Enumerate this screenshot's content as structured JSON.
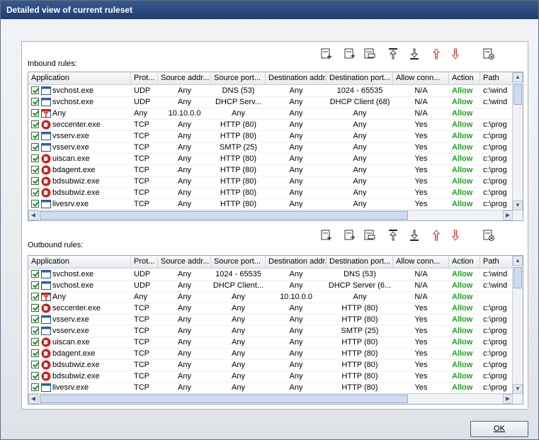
{
  "window": {
    "title": "Detailed view of current ruleset"
  },
  "inbound": {
    "label": "Inbound rules:",
    "columns": [
      "Application",
      "Prot...",
      "Source addr...",
      "Source port...",
      "Destination addr...",
      "Destination port...",
      "Allow conn...",
      "Action",
      "Path"
    ],
    "rows": [
      {
        "app": "svchost.exe",
        "icon": "window-icon",
        "prot": "UDP",
        "src": "Any",
        "sport": "DNS (53)",
        "dst": "Any",
        "dport": "1024 - 65535",
        "conn": "N/A",
        "action": "Allow",
        "path": "c:\\wind"
      },
      {
        "app": "svchost.exe",
        "icon": "window-icon",
        "prot": "UDP",
        "src": "Any",
        "sport": "DHCP Serv...",
        "dst": "Any",
        "dport": "DHCP Client (68)",
        "conn": "N/A",
        "action": "Allow",
        "path": "c:\\wind"
      },
      {
        "app": "Any",
        "icon": "any-icon",
        "prot": "Any",
        "src": "10.10.0.0",
        "sport": "Any",
        "dst": "Any",
        "dport": "Any",
        "conn": "N/A",
        "action": "Allow",
        "path": ""
      },
      {
        "app": "seccenter.exe",
        "icon": "bitdefender-icon",
        "prot": "TCP",
        "src": "Any",
        "sport": "HTTP (80)",
        "dst": "Any",
        "dport": "Any",
        "conn": "Yes",
        "action": "Allow",
        "path": "c:\\prog"
      },
      {
        "app": "vsserv.exe",
        "icon": "window-icon",
        "prot": "TCP",
        "src": "Any",
        "sport": "HTTP (80)",
        "dst": "Any",
        "dport": "Any",
        "conn": "Yes",
        "action": "Allow",
        "path": "c:\\prog"
      },
      {
        "app": "vsserv.exe",
        "icon": "window-icon",
        "prot": "TCP",
        "src": "Any",
        "sport": "SMTP (25)",
        "dst": "Any",
        "dport": "Any",
        "conn": "Yes",
        "action": "Allow",
        "path": "c:\\prog"
      },
      {
        "app": "uiscan.exe",
        "icon": "bitdefender-icon",
        "prot": "TCP",
        "src": "Any",
        "sport": "HTTP (80)",
        "dst": "Any",
        "dport": "Any",
        "conn": "Yes",
        "action": "Allow",
        "path": "c:\\prog"
      },
      {
        "app": "bdagent.exe",
        "icon": "bitdefender-icon",
        "prot": "TCP",
        "src": "Any",
        "sport": "HTTP (80)",
        "dst": "Any",
        "dport": "Any",
        "conn": "Yes",
        "action": "Allow",
        "path": "c:\\prog"
      },
      {
        "app": "bdsubwiz.exe",
        "icon": "bitdefender-icon",
        "prot": "TCP",
        "src": "Any",
        "sport": "HTTP (80)",
        "dst": "Any",
        "dport": "Any",
        "conn": "Yes",
        "action": "Allow",
        "path": "c:\\prog"
      },
      {
        "app": "bdsubwiz.exe",
        "icon": "bitdefender-icon",
        "prot": "TCP",
        "src": "Any",
        "sport": "HTTP (80)",
        "dst": "Any",
        "dport": "Any",
        "conn": "Yes",
        "action": "Allow",
        "path": "c:\\prog"
      },
      {
        "app": "livesrv.exe",
        "icon": "window-icon",
        "prot": "TCP",
        "src": "Any",
        "sport": "HTTP (80)",
        "dst": "Any",
        "dport": "Any",
        "conn": "Yes",
        "action": "Allow",
        "path": "c:\\prog"
      }
    ]
  },
  "outbound": {
    "label": "Outbound rules:",
    "columns": [
      "Application",
      "Prot...",
      "Source addr...",
      "Source port...",
      "Destination addr...",
      "Destination port...",
      "Allow conn...",
      "Action",
      "Path"
    ],
    "rows": [
      {
        "app": "svchost.exe",
        "icon": "window-icon",
        "prot": "UDP",
        "src": "Any",
        "sport": "1024 - 65535",
        "dst": "Any",
        "dport": "DNS (53)",
        "conn": "N/A",
        "action": "Allow",
        "path": "c:\\wind"
      },
      {
        "app": "svchost.exe",
        "icon": "window-icon",
        "prot": "UDP",
        "src": "Any",
        "sport": "DHCP Client...",
        "dst": "Any",
        "dport": "DHCP Server (6...",
        "conn": "N/A",
        "action": "Allow",
        "path": "c:\\wind"
      },
      {
        "app": "Any",
        "icon": "any-icon",
        "prot": "Any",
        "src": "Any",
        "sport": "Any",
        "dst": "10.10.0.0",
        "dport": "Any",
        "conn": "N/A",
        "action": "Allow",
        "path": ""
      },
      {
        "app": "seccenter.exe",
        "icon": "bitdefender-icon",
        "prot": "TCP",
        "src": "Any",
        "sport": "Any",
        "dst": "Any",
        "dport": "HTTP (80)",
        "conn": "Yes",
        "action": "Allow",
        "path": "c:\\prog"
      },
      {
        "app": "vsserv.exe",
        "icon": "window-icon",
        "prot": "TCP",
        "src": "Any",
        "sport": "Any",
        "dst": "Any",
        "dport": "HTTP (80)",
        "conn": "Yes",
        "action": "Allow",
        "path": "c:\\prog"
      },
      {
        "app": "vsserv.exe",
        "icon": "window-icon",
        "prot": "TCP",
        "src": "Any",
        "sport": "Any",
        "dst": "Any",
        "dport": "SMTP (25)",
        "conn": "Yes",
        "action": "Allow",
        "path": "c:\\prog"
      },
      {
        "app": "uiscan.exe",
        "icon": "bitdefender-icon",
        "prot": "TCP",
        "src": "Any",
        "sport": "Any",
        "dst": "Any",
        "dport": "HTTP (80)",
        "conn": "Yes",
        "action": "Allow",
        "path": "c:\\prog"
      },
      {
        "app": "bdagent.exe",
        "icon": "bitdefender-icon",
        "prot": "TCP",
        "src": "Any",
        "sport": "Any",
        "dst": "Any",
        "dport": "HTTP (80)",
        "conn": "Yes",
        "action": "Allow",
        "path": "c:\\prog"
      },
      {
        "app": "bdsubwiz.exe",
        "icon": "bitdefender-icon",
        "prot": "TCP",
        "src": "Any",
        "sport": "Any",
        "dst": "Any",
        "dport": "HTTP (80)",
        "conn": "Yes",
        "action": "Allow",
        "path": "c:\\prog"
      },
      {
        "app": "bdsubwiz.exe",
        "icon": "bitdefender-icon",
        "prot": "TCP",
        "src": "Any",
        "sport": "Any",
        "dst": "Any",
        "dport": "HTTP (80)",
        "conn": "Yes",
        "action": "Allow",
        "path": "c:\\prog"
      },
      {
        "app": "livesrv.exe",
        "icon": "window-icon",
        "prot": "TCP",
        "src": "Any",
        "sport": "Any",
        "dst": "Any",
        "dport": "HTTP (80)",
        "conn": "Yes",
        "action": "Allow",
        "path": "c:\\prog"
      }
    ]
  },
  "toolbar_icons": [
    "add-rule-icon",
    "edit-rule-icon",
    "delete-rule-icon",
    "move-top-icon",
    "move-bottom-icon",
    "move-up-icon",
    "move-down-icon",
    "reset-icon"
  ],
  "colors": {
    "allow": "#1fa21f",
    "title_bar": "#1f3d71"
  },
  "buttons": {
    "ok": "OK"
  }
}
